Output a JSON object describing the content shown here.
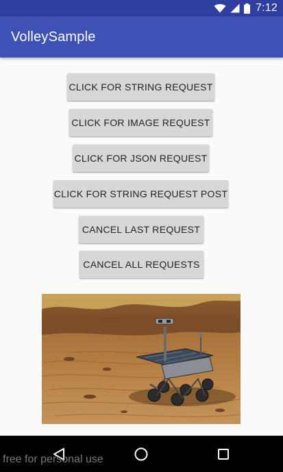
{
  "status_bar": {
    "time": "7:12",
    "icons": [
      "wifi-icon",
      "cell-signal-icon",
      "battery-icon"
    ],
    "background": "#303f9f"
  },
  "app_bar": {
    "title": "VolleySample",
    "background": "#3f51b5"
  },
  "buttons": {
    "string_request": "CLICK FOR STRING REQUEST",
    "image_request": "CLICK FOR IMAGE REQUEST",
    "json_request": "CLICK FOR JSON REQUEST",
    "string_request_post": "CLICK FOR STRING REQUEST POST",
    "cancel_last": "CANCEL LAST REQUEST",
    "cancel_all": "CANCEL ALL REQUESTS"
  },
  "image": {
    "subject": "mars-rover-photo"
  },
  "nav_bar": {
    "icons": [
      "back-icon",
      "home-icon",
      "recents-icon"
    ]
  },
  "watermark": "free for personal use"
}
